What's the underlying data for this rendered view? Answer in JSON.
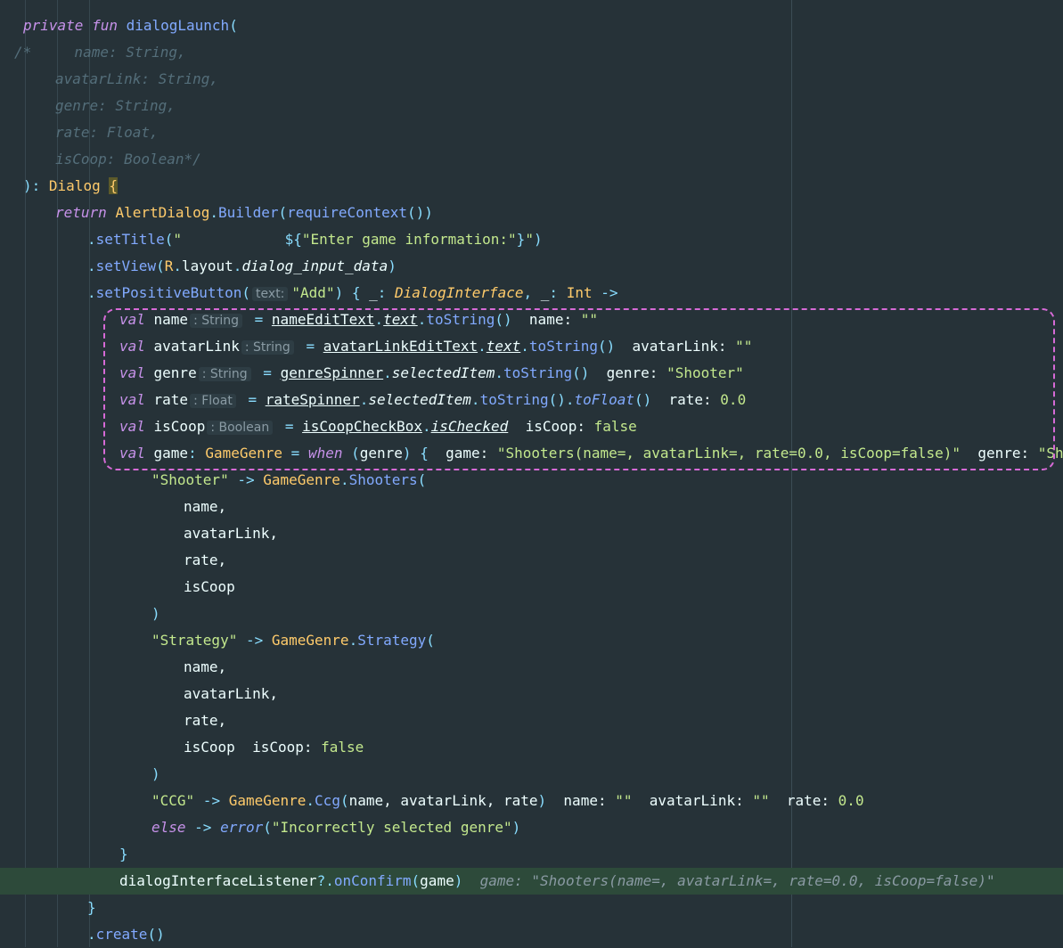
{
  "editor": {
    "lines": [
      {
        "indent": 26,
        "tokens": [
          [
            "kw",
            "private fun "
          ],
          [
            "fn",
            "dialogLaunch"
          ],
          [
            "op",
            "("
          ]
        ]
      },
      {
        "indent": 16,
        "tokens": [
          [
            "cm",
            "/*     name: String,"
          ]
        ]
      },
      {
        "indent": 62,
        "tokens": [
          [
            "cm",
            "avatarLink: String,"
          ]
        ]
      },
      {
        "indent": 62,
        "tokens": [
          [
            "cm",
            "genre: String,"
          ]
        ]
      },
      {
        "indent": 62,
        "tokens": [
          [
            "cm",
            "rate: Float,"
          ]
        ]
      },
      {
        "indent": 62,
        "tokens": [
          [
            "cm",
            "isCoop: Boolean*/"
          ]
        ]
      },
      {
        "indent": 26,
        "tokens": [
          [
            "op",
            "): "
          ],
          [
            "ty",
            "Dialog "
          ],
          [
            "brace",
            "{"
          ]
        ]
      },
      {
        "indent": 62,
        "tokens": [
          [
            "kw",
            "return "
          ],
          [
            "ty",
            "AlertDialog"
          ],
          [
            "op",
            "."
          ],
          [
            "fn",
            "Builder"
          ],
          [
            "op",
            "("
          ],
          [
            "fn",
            "requireContext"
          ],
          [
            "op",
            "())"
          ]
        ]
      },
      {
        "indent": 98,
        "tokens": [
          [
            "op",
            "."
          ],
          [
            "fn",
            "setTitle"
          ],
          [
            "op",
            "("
          ],
          [
            "str",
            "\"            "
          ],
          [
            "op",
            "${"
          ],
          [
            "str",
            "\"Enter game information:\""
          ],
          [
            "op",
            "}"
          ],
          [
            "str",
            "\""
          ],
          [
            "op",
            ")"
          ]
        ]
      },
      {
        "indent": 98,
        "tokens": [
          [
            "op",
            "."
          ],
          [
            "fn",
            "setView"
          ],
          [
            "op",
            "("
          ],
          [
            "ty",
            "R"
          ],
          [
            "op",
            "."
          ],
          [
            "pl",
            "layout"
          ],
          [
            "op",
            "."
          ],
          [
            "it",
            "dialog_input_data"
          ],
          [
            "op",
            ")"
          ]
        ]
      },
      {
        "indent": 98,
        "tokens": [
          [
            "op",
            "."
          ],
          [
            "fn",
            "setPositiveButton"
          ],
          [
            "op",
            "("
          ],
          [
            "hint",
            "text:"
          ],
          [
            "str",
            "\"Add\""
          ],
          [
            "op",
            ") { "
          ],
          [
            "pl",
            "_"
          ],
          [
            "op",
            ": "
          ],
          [
            "ty-i",
            "DialogInterface"
          ],
          [
            "op",
            ", "
          ],
          [
            "pl",
            "_"
          ],
          [
            "op",
            ": "
          ],
          [
            "ty",
            "Int "
          ],
          [
            "op",
            "->"
          ]
        ]
      },
      {
        "indent": 134,
        "tokens": [
          [
            "kw",
            "val "
          ],
          [
            "pl",
            "name"
          ],
          [
            "hint",
            ": String"
          ],
          [
            "op",
            " = "
          ],
          [
            "ul",
            "nameEditText"
          ],
          [
            "op",
            "."
          ],
          [
            "ul-i",
            "text"
          ],
          [
            "op",
            "."
          ],
          [
            "fn",
            "toString"
          ],
          [
            "op",
            "()"
          ],
          [
            "dbgk",
            "  name: "
          ],
          [
            "dbg",
            "\"\""
          ]
        ]
      },
      {
        "indent": 134,
        "tokens": [
          [
            "kw",
            "val "
          ],
          [
            "pl",
            "avatarLink"
          ],
          [
            "hint",
            ": String"
          ],
          [
            "op",
            " = "
          ],
          [
            "ul",
            "avatarLinkEditText"
          ],
          [
            "op",
            "."
          ],
          [
            "ul-i",
            "text"
          ],
          [
            "op",
            "."
          ],
          [
            "fn",
            "toString"
          ],
          [
            "op",
            "()"
          ],
          [
            "dbgk",
            "  avatarLink: "
          ],
          [
            "dbg",
            "\"\""
          ]
        ]
      },
      {
        "indent": 134,
        "tokens": [
          [
            "kw",
            "val "
          ],
          [
            "pl",
            "genre"
          ],
          [
            "hint",
            ": String"
          ],
          [
            "op",
            " = "
          ],
          [
            "ul",
            "genreSpinner"
          ],
          [
            "op",
            "."
          ],
          [
            "it",
            "selectedItem"
          ],
          [
            "op",
            "."
          ],
          [
            "fn",
            "toString"
          ],
          [
            "op",
            "()"
          ],
          [
            "dbgk",
            "  genre: "
          ],
          [
            "dbg",
            "\"Shooter\""
          ]
        ]
      },
      {
        "indent": 134,
        "tokens": [
          [
            "kw",
            "val "
          ],
          [
            "pl",
            "rate"
          ],
          [
            "hint",
            ": Float"
          ],
          [
            "op",
            " = "
          ],
          [
            "ul",
            "rateSpinner"
          ],
          [
            "op",
            "."
          ],
          [
            "it",
            "selectedItem"
          ],
          [
            "op",
            "."
          ],
          [
            "fn",
            "toString"
          ],
          [
            "op",
            "()."
          ],
          [
            "fn-i",
            "toFloat"
          ],
          [
            "op",
            "()"
          ],
          [
            "dbgk",
            "  rate: "
          ],
          [
            "dbg",
            "0.0"
          ]
        ]
      },
      {
        "indent": 134,
        "tokens": [
          [
            "kw",
            "val "
          ],
          [
            "pl",
            "isCoop"
          ],
          [
            "hint",
            ": Boolean"
          ],
          [
            "op",
            " = "
          ],
          [
            "ul",
            "isCoopCheckBox"
          ],
          [
            "op",
            "."
          ],
          [
            "ul-i",
            "isChecked"
          ],
          [
            "dbgk",
            "  isCoop: "
          ],
          [
            "dbg",
            "false"
          ]
        ]
      },
      {
        "indent": 134,
        "tokens": [
          [
            "kw",
            "val "
          ],
          [
            "pl",
            "game"
          ],
          [
            "op",
            ": "
          ],
          [
            "ty",
            "GameGenre"
          ],
          [
            "op",
            " = "
          ],
          [
            "kw",
            "when "
          ],
          [
            "op",
            "("
          ],
          [
            "pl",
            "genre"
          ],
          [
            "op",
            ") {"
          ],
          [
            "dbgk",
            "  game: "
          ],
          [
            "dbg",
            "\"Shooters(name=, avatarLink=, rate=0.0, isCoop=false)\""
          ],
          [
            "dbgk",
            "  genre: "
          ],
          [
            "dbg",
            "\"Shooter\""
          ]
        ]
      },
      {
        "indent": 170,
        "tokens": [
          [
            "str",
            "\"Shooter\""
          ],
          [
            "op",
            " -> "
          ],
          [
            "ty",
            "GameGenre"
          ],
          [
            "op",
            "."
          ],
          [
            "fn",
            "Shooters"
          ],
          [
            "op",
            "("
          ]
        ]
      },
      {
        "indent": 206,
        "tokens": [
          [
            "pl",
            "name,"
          ]
        ]
      },
      {
        "indent": 206,
        "tokens": [
          [
            "pl",
            "avatarLink,"
          ]
        ]
      },
      {
        "indent": 206,
        "tokens": [
          [
            "pl",
            "rate,"
          ]
        ]
      },
      {
        "indent": 206,
        "tokens": [
          [
            "pl",
            "isCoop"
          ]
        ]
      },
      {
        "indent": 170,
        "tokens": [
          [
            "op",
            ")"
          ]
        ]
      },
      {
        "indent": 170,
        "tokens": [
          [
            "str",
            "\"Strategy\""
          ],
          [
            "op",
            " -> "
          ],
          [
            "ty",
            "GameGenre"
          ],
          [
            "op",
            "."
          ],
          [
            "fn",
            "Strategy"
          ],
          [
            "op",
            "("
          ]
        ]
      },
      {
        "indent": 206,
        "tokens": [
          [
            "pl",
            "name,"
          ]
        ]
      },
      {
        "indent": 206,
        "tokens": [
          [
            "pl",
            "avatarLink,"
          ]
        ]
      },
      {
        "indent": 206,
        "tokens": [
          [
            "pl",
            "rate,"
          ]
        ]
      },
      {
        "indent": 206,
        "tokens": [
          [
            "pl",
            "isCoop"
          ],
          [
            "dbgk",
            "  isCoop: "
          ],
          [
            "dbg",
            "false"
          ]
        ]
      },
      {
        "indent": 170,
        "tokens": [
          [
            "op",
            ")"
          ]
        ]
      },
      {
        "indent": 170,
        "tokens": [
          [
            "str",
            "\"CCG\""
          ],
          [
            "op",
            " -> "
          ],
          [
            "ty",
            "GameGenre"
          ],
          [
            "op",
            "."
          ],
          [
            "fn",
            "Ccg"
          ],
          [
            "op",
            "("
          ],
          [
            "pl",
            "name, avatarLink, rate"
          ],
          [
            "op",
            ")"
          ],
          [
            "dbgk",
            "  name: "
          ],
          [
            "dbg",
            "\"\""
          ],
          [
            "dbgk",
            "  avatarLink: "
          ],
          [
            "dbg",
            "\"\""
          ],
          [
            "dbgk",
            "  rate: "
          ],
          [
            "dbg",
            "0.0"
          ]
        ]
      },
      {
        "indent": 170,
        "tokens": [
          [
            "kw",
            "else "
          ],
          [
            "op",
            "-> "
          ],
          [
            "fn-i",
            "error"
          ],
          [
            "op",
            "("
          ],
          [
            "str",
            "\"Incorrectly selected genre\""
          ],
          [
            "op",
            ")"
          ]
        ]
      },
      {
        "indent": 134,
        "tokens": [
          [
            "op",
            "}"
          ]
        ]
      },
      {
        "indent": 134,
        "exec": true,
        "tokens": [
          [
            "pl",
            "dialogInterfaceListener"
          ],
          [
            "op",
            "?."
          ],
          [
            "fn",
            "onConfirm"
          ],
          [
            "op",
            "("
          ],
          [
            "pl",
            "game"
          ],
          [
            "op",
            ")"
          ],
          [
            "dim",
            "  game: \"Shooters(name=, avatarLink=, rate=0.0, isCoop=false)\""
          ]
        ]
      },
      {
        "indent": 98,
        "tokens": [
          [
            "op",
            "}"
          ]
        ]
      },
      {
        "indent": 98,
        "tokens": [
          [
            "op",
            "."
          ],
          [
            "fn",
            "create"
          ],
          [
            "op",
            "()"
          ]
        ]
      }
    ]
  },
  "colors": {
    "background": "#263238",
    "keyword": "#c792ea",
    "function": "#82aaff",
    "type": "#ffcb6b",
    "string": "#c3e88d",
    "comment": "#546e7a",
    "selection_border": "#d66ad6",
    "exec_line": "#2d4a3a"
  }
}
